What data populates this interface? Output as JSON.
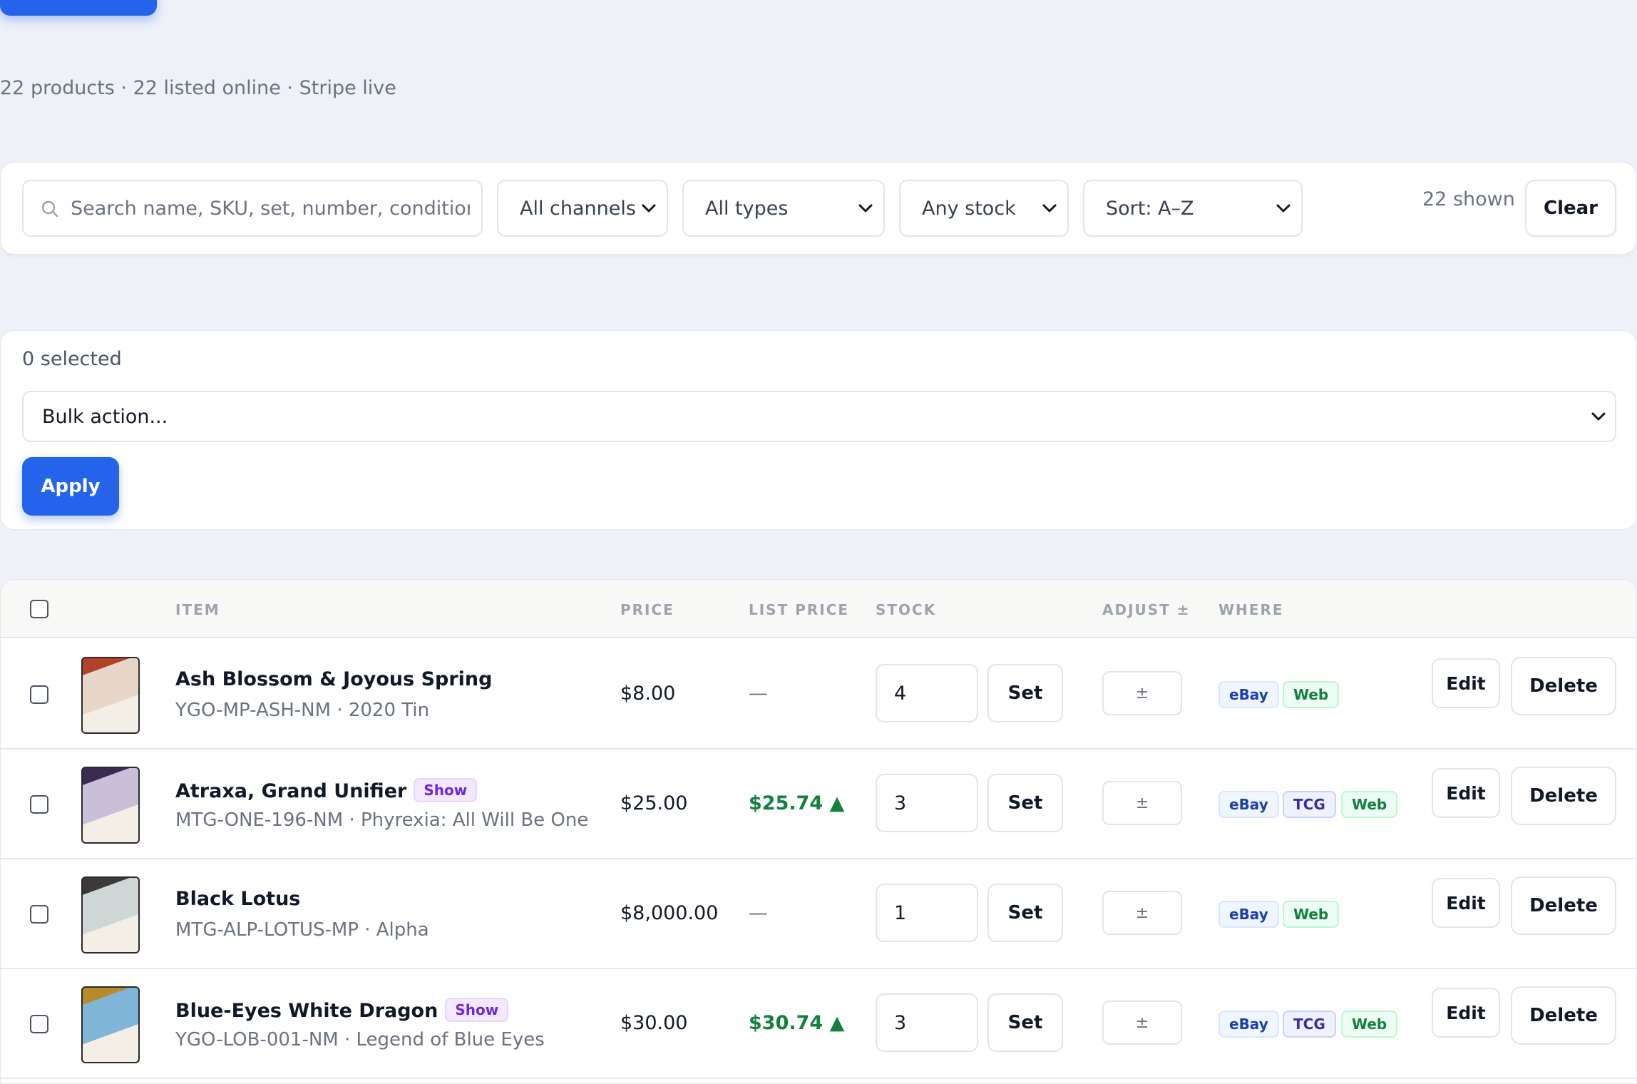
{
  "summary": "22 products · 22 listed online · Stripe live",
  "filters": {
    "search_placeholder": "Search name, SKU, set, number, condition",
    "channel": "All channels",
    "type": "All types",
    "stock": "Any stock",
    "sort": "Sort: A–Z",
    "shown": "22 shown",
    "clear_label": "Clear"
  },
  "bulk": {
    "selected": "0 selected",
    "action_placeholder": "Bulk action...",
    "apply_label": "Apply"
  },
  "table": {
    "headers": {
      "item": "ITEM",
      "price": "PRICE",
      "list_price": "LIST PRICE",
      "stock": "STOCK",
      "adjust": "ADJUST ±",
      "where": "WHERE"
    },
    "set_label": "Set",
    "adjust_placeholder": "±",
    "edit_label": "Edit",
    "delete_label": "Delete",
    "rows": [
      {
        "name": "Ash Blossom & Joyous Spring",
        "badge": "",
        "sub": "YGO-MP-ASH-NM · 2020 Tin",
        "price": "$8.00",
        "list_price": "—",
        "stock": "4",
        "channels": [
          "eBay",
          "Web"
        ],
        "thumb_colors": [
          "#b0432a",
          "#e8d7c8"
        ]
      },
      {
        "name": "Atraxa, Grand Unifier",
        "badge": "Show",
        "sub": "MTG-ONE-196-NM · Phyrexia: All Will Be One",
        "price": "$25.00",
        "list_price": "$25.74 ▲",
        "stock": "3",
        "channels": [
          "eBay",
          "TCG",
          "Web"
        ],
        "thumb_colors": [
          "#3b2a52",
          "#c9bfd8"
        ]
      },
      {
        "name": "Black Lotus",
        "badge": "",
        "sub": "MTG-ALP-LOTUS-MP · Alpha",
        "price": "$8,000.00",
        "list_price": "—",
        "stock": "1",
        "channels": [
          "eBay",
          "Web"
        ],
        "thumb_colors": [
          "#3a3a3a",
          "#cfd6d6"
        ]
      },
      {
        "name": "Blue-Eyes White Dragon",
        "badge": "Show",
        "sub": "YGO-LOB-001-NM · Legend of Blue Eyes",
        "price": "$30.00",
        "list_price": "$30.74 ▲",
        "stock": "3",
        "channels": [
          "eBay",
          "TCG",
          "Web"
        ],
        "thumb_colors": [
          "#b98a2a",
          "#7fb5d6"
        ]
      }
    ]
  }
}
